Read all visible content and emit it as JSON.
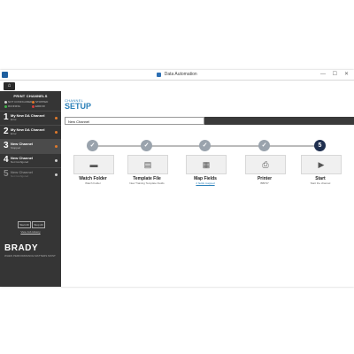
{
  "window": {
    "title": "Data Automation",
    "controls": {
      "minimize": "—",
      "maximize": "☐",
      "close": "✕"
    }
  },
  "toolbar": {
    "home_icon": "⌂"
  },
  "sidebar": {
    "header": "PRINT CHANNELS",
    "legend": [
      {
        "label": "NOT CONFIGURED",
        "color": "#cfcfcf"
      },
      {
        "label": "STOPPED",
        "color": "#e07a2c"
      },
      {
        "label": "RUNNING",
        "color": "#3fb24a"
      },
      {
        "label": "ERROR",
        "color": "#d33b3b"
      }
    ],
    "channels": [
      {
        "number": "1",
        "name": "My New DA Channel",
        "status": "Error",
        "color": "#e07a2c"
      },
      {
        "number": "2",
        "name": "My New DA Channel",
        "status": "Error",
        "color": "#e07a2c"
      },
      {
        "number": "3",
        "name": "New Channel",
        "status": "Stopped",
        "color": "#e07a2c"
      },
      {
        "number": "4",
        "name": "New Channel",
        "status": "Not Configured",
        "color": "#cfcfcf"
      },
      {
        "number": "5",
        "name": "New Channel",
        "status": "Not Configured",
        "color": "#cfcfcf"
      }
    ],
    "start_all": "Start All",
    "stop_all": "Stop All",
    "view_history": "View Job History",
    "brand_logo": "BRADY",
    "brand_tagline": "WHEN PERFORMANCE MATTERS MOST"
  },
  "main": {
    "section_label": "CHANNEL",
    "section_title": "SETUP",
    "channel_name_value": "New Channel",
    "steps": [
      {
        "marker": "✓",
        "icon": "folder-icon",
        "glyph": "▬",
        "title": "Watch Folder",
        "subtitle": "Watch Folder"
      },
      {
        "marker": "✓",
        "icon": "document-icon",
        "glyph": "▤",
        "title": "Template File",
        "subtitle": "New Training Template Fields"
      },
      {
        "marker": "✓",
        "icon": "grid-icon",
        "glyph": "▦",
        "title": "Map Fields",
        "subtitle": "2 fields mapped"
      },
      {
        "marker": "✓",
        "icon": "printer-icon",
        "glyph": "⎙",
        "title": "Printer",
        "subtitle": "BBP37"
      },
      {
        "marker": "5",
        "icon": "play-icon",
        "glyph": "▶",
        "title": "Start",
        "subtitle": "Start the channel"
      }
    ]
  }
}
